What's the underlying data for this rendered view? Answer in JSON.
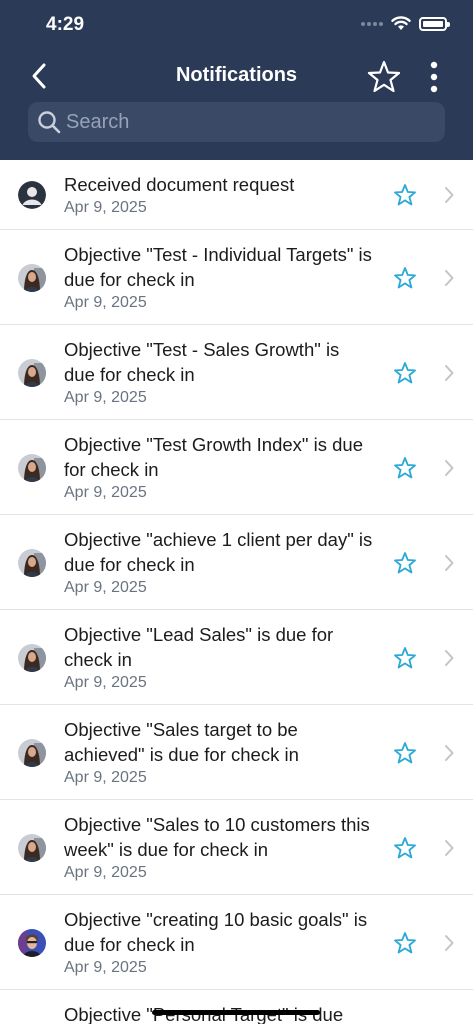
{
  "status_bar": {
    "time": "4:29"
  },
  "nav": {
    "title": "Notifications"
  },
  "search": {
    "placeholder": "Search"
  },
  "notifications": [
    {
      "title": "Received document request",
      "date": "Apr 9, 2025",
      "avatar": "generic-user"
    },
    {
      "title": "Objective \"Test - Individual Targets\" is due for check in",
      "date": "Apr 9, 2025",
      "avatar": "woman-photo"
    },
    {
      "title": "Objective \"Test - Sales Growth\" is due for check in",
      "date": "Apr 9, 2025",
      "avatar": "woman-photo"
    },
    {
      "title": "Objective \"Test Growth Index\" is due for check in",
      "date": "Apr 9, 2025",
      "avatar": "woman-photo"
    },
    {
      "title": "Objective \"achieve 1 client per day\" is due for check in",
      "date": "Apr 9, 2025",
      "avatar": "woman-photo"
    },
    {
      "title": "Objective \"Lead Sales\" is due for check in",
      "date": "Apr 9, 2025",
      "avatar": "woman-photo"
    },
    {
      "title": "Objective \"Sales target to be achieved\" is due for check in",
      "date": "Apr 9, 2025",
      "avatar": "woman-photo"
    },
    {
      "title": "Objective \"Sales to 10 customers this week\" is due for check in",
      "date": "Apr 9, 2025",
      "avatar": "woman-photo"
    },
    {
      "title": "Objective \"creating 10 basic goals\" is due for check in",
      "date": "Apr 9, 2025",
      "avatar": "man-photo"
    },
    {
      "title": "Objective \"Personal Target\" is due",
      "date": "",
      "avatar": "none"
    }
  ],
  "colors": {
    "header_bg": "#2b3a57",
    "search_bg": "#3a4966",
    "star_accent": "#2aa8d8",
    "date_text": "#6a7380"
  }
}
